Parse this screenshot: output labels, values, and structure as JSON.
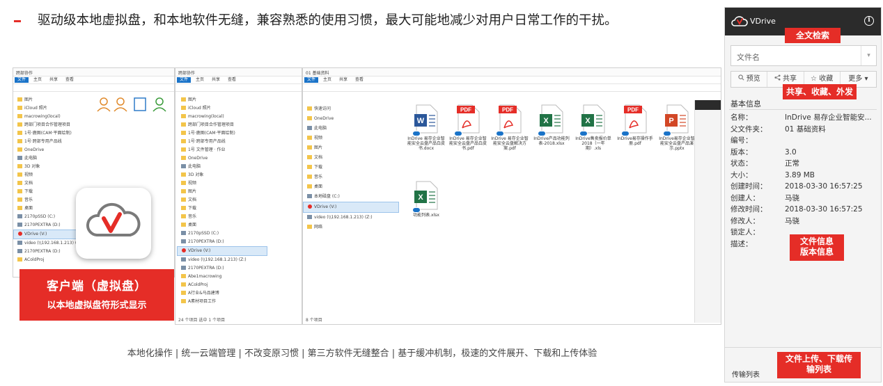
{
  "headline": "驱动级本地虚拟盘，和本地软件无缝，兼容熟悉的使用习惯，最大可能地减少对用户日常工作的干扰。",
  "caption": "本地化操作 | 统一云端管理 | 不改变原习惯 | 第三方软件无缝整合 | 基于缓冲机制，极速的文件展开、下载和上传体验",
  "client_badge": {
    "title": "客户端（虚拟盘）",
    "subtitle": "以本地虚拟盘符形式显示"
  },
  "explorer": {
    "ribbon_tabs": [
      "文件",
      "主页",
      "共享",
      "查看"
    ],
    "win2_title": "跨部协作",
    "win3_title": "01 基础资料",
    "win3_status": "8 个项目",
    "win2_status": "24 个项目   选中 1 个项目",
    "win2_tree": [
      "图片",
      "iCloud 照片",
      "macrowing(local)",
      "跨部门项目合作管理项目",
      "1号·鹿图(CAM·平面绘制)",
      "1号·跨部专用产品线",
      "1号 文件管理 · 作业",
      "OneDrive",
      "此电脑",
      "3D 对象",
      "视频",
      "图片",
      "文档",
      "下载",
      "音乐",
      "桌面",
      "2170pSSD (C:)",
      "2170PEXTRA (D:)",
      "VDrive (V:)",
      "video (\\\\192.168.1.213) (Z:)",
      "2170PEXTRA (D:)",
      "Abe1macrowing",
      "AColdProj",
      "A行业&马品建博",
      "A素材项目工作"
    ],
    "win3_tree": [
      "快速访问",
      "OneDrive",
      "此电脑",
      "视频",
      "图片",
      "文档",
      "下载",
      "音乐",
      "桌面",
      "本地磁盘 (C:)",
      "VDrive (V:)",
      "video (\\\\192.168.1.213) (Z:)",
      "网络"
    ],
    "win3_drive_selected": "VDrive (V:)"
  },
  "files": [
    {
      "type": "docx",
      "name": "InDrive 易存企业智能安全云盘产品白皮书.docx",
      "badge": "W",
      "color": "#2b579a"
    },
    {
      "type": "pdf",
      "name": "InDrive 易存企业智能安全云盘产品白皮书.pdf",
      "badge": "PDF",
      "color": "#e52d27"
    },
    {
      "type": "pdf",
      "name": "InDrive 易存企业智能安全云盘解决方案.pdf",
      "badge": "PDF",
      "color": "#e52d27"
    },
    {
      "type": "xlsx",
      "name": "InDrive产品功能列表-2018.xlsx",
      "badge": "X",
      "color": "#217346"
    },
    {
      "type": "xlsx",
      "name": "InDrive售卖报价单2018（一年期）.xls",
      "badge": "X",
      "color": "#217346"
    },
    {
      "type": "pdf",
      "name": "InDrive易存操作手册.pdf",
      "badge": "PDF",
      "color": "#e52d27"
    },
    {
      "type": "pptx",
      "name": "InDrive易存企业智能安全云盘产品演示.pptx",
      "badge": "P",
      "color": "#d24726"
    },
    {
      "type": "xlsx",
      "name": "功能列表.xlsx",
      "badge": "X",
      "color": "#217346"
    }
  ],
  "panel": {
    "logo_text": "VDrive",
    "search_placeholder": "文件名",
    "caret": "▾",
    "actions": [
      "预览",
      "共享",
      "收藏",
      "更多 ▾"
    ],
    "section_title": "基本信息",
    "properties": [
      {
        "k": "名称：",
        "v": "InDrive 易存企业智能安..."
      },
      {
        "k": "父文件夹：",
        "v": "01 基础资料"
      },
      {
        "k": "编号：",
        "v": ""
      },
      {
        "k": "版本：",
        "v": "3.0"
      },
      {
        "k": "状态：",
        "v": "正常"
      },
      {
        "k": "大小：",
        "v": "3.89 MB"
      },
      {
        "k": "创建时间：",
        "v": "2018-03-30 16:57:25"
      },
      {
        "k": "创建人：",
        "v": "马骁"
      },
      {
        "k": "修改时间：",
        "v": "2018-03-30 16:57:25"
      },
      {
        "k": "修改人：",
        "v": "马骁"
      },
      {
        "k": "锁定人：",
        "v": ""
      },
      {
        "k": "描述：",
        "v": ""
      }
    ],
    "transfer_list": "传输列表"
  },
  "tags": {
    "fulltext": "全文检索",
    "share": "共享、收藏、外发",
    "fileinfo_1": "文件信息",
    "fileinfo_2": "版本信息",
    "upload_1": "文件上传、下载传",
    "upload_2": "输列表"
  },
  "colors": {
    "accent": "#e52d27",
    "panel_header": "#2b2b2b",
    "ribbon_active": "#1a73c8"
  }
}
